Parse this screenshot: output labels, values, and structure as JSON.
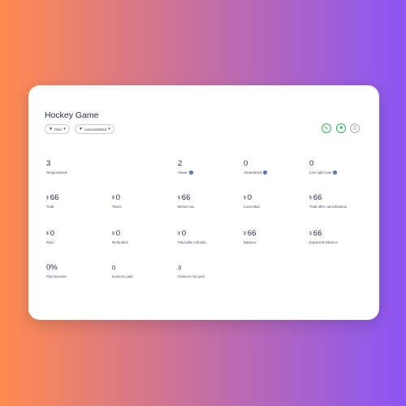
{
  "title": "Hockey Game",
  "filters": {
    "filter_label": "Filter",
    "sort_label": "Last submitted"
  },
  "actions": [
    {
      "icon": "refresh-icon"
    },
    {
      "icon": "export-icon"
    },
    {
      "icon": "print-icon"
    }
  ],
  "stats": {
    "respondents": {
      "value": "3",
      "label": "Respondents"
    },
    "views": {
      "value": "2",
      "label": "Views"
    },
    "abandoned": {
      "value": "0",
      "label": "Abandoned"
    },
    "live_right_now": {
      "value": "0",
      "label": "Live right now"
    },
    "total": {
      "currency": "$",
      "value": "66",
      "label": "Total"
    },
    "taxes": {
      "currency": "$",
      "value": "0",
      "label": "Taxes"
    },
    "before_tax": {
      "currency": "$",
      "value": "66",
      "label": "Before tax"
    },
    "cancelled": {
      "currency": "$",
      "value": "0",
      "label": "Cancelled"
    },
    "total_after_cancellations": {
      "currency": "$",
      "value": "66",
      "label": "Total after cancellations"
    },
    "paid": {
      "currency": "$",
      "value": "0",
      "label": "Paid"
    },
    "refunded": {
      "currency": "$",
      "value": "0",
      "label": "Refunded"
    },
    "paid_after_refunds": {
      "currency": "$",
      "value": "0",
      "label": "Paid after refunds"
    },
    "balance": {
      "currency": "$",
      "value": "66",
      "label": "Balance"
    },
    "expected_balance": {
      "currency": "$",
      "value": "66",
      "label": "Expected balance"
    },
    "paid_amount": {
      "value": "0%",
      "label": "Paid amount"
    },
    "invoices_paid": {
      "value": "0",
      "label": "Invoices paid"
    },
    "invoices_not_paid": {
      "value": "3",
      "label": "Invoices not paid"
    }
  },
  "colors": {
    "accent_green": "#2fae5a",
    "text_dark": "#1f2a44",
    "info_icon": "#4a6ea8"
  }
}
